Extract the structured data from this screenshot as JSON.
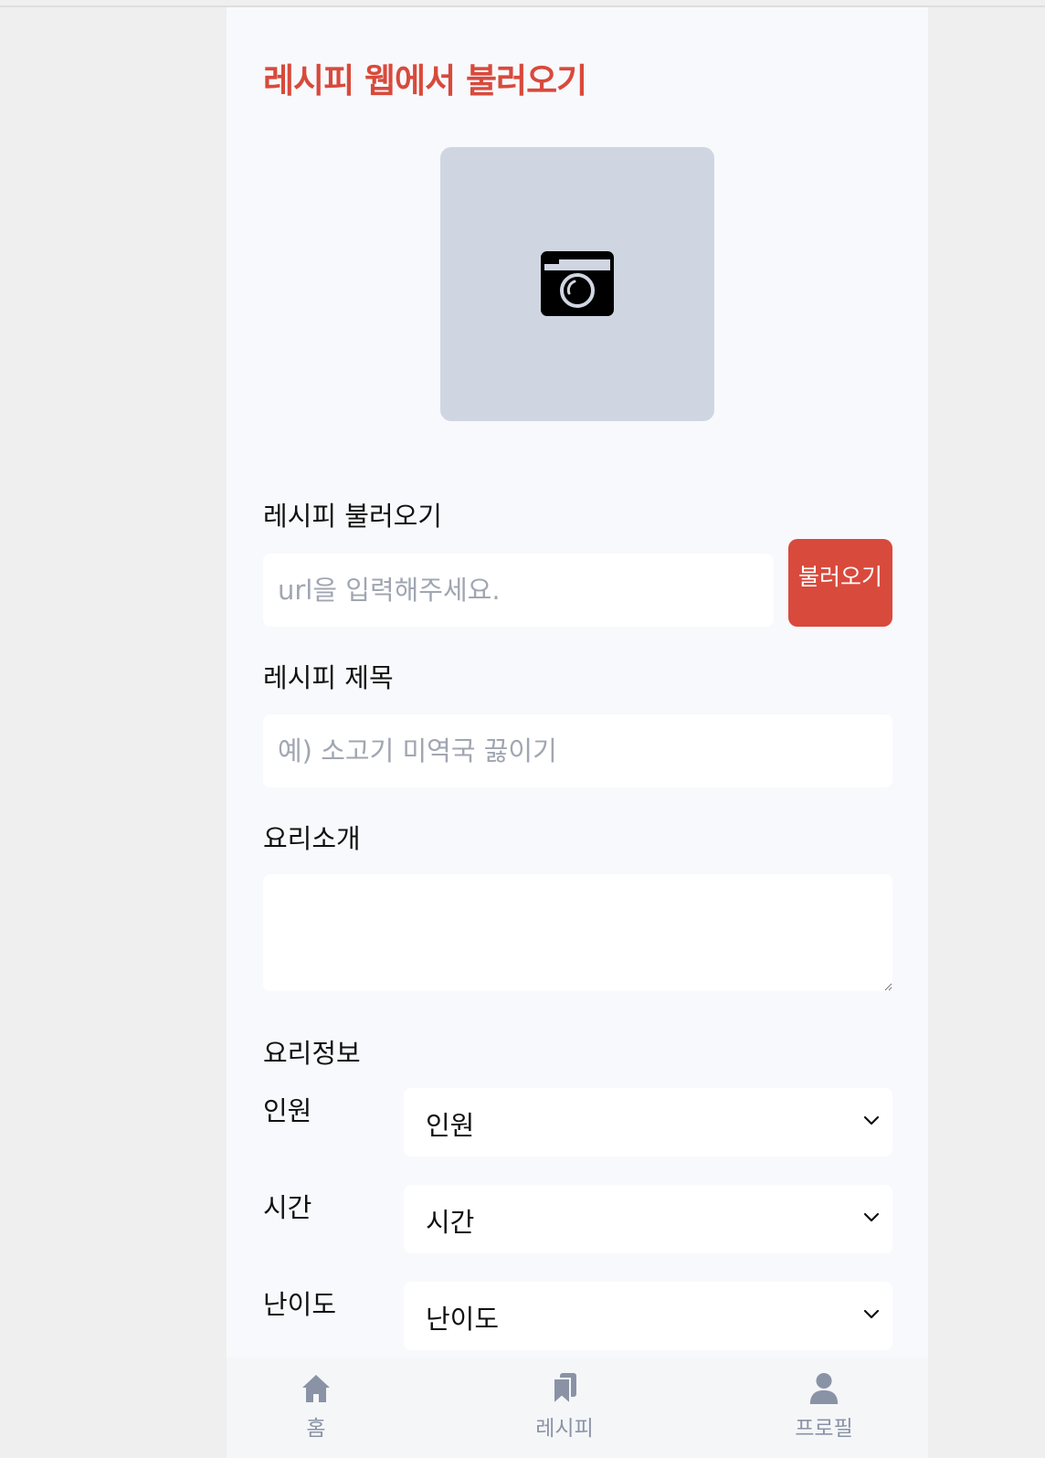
{
  "header": {
    "title": "레시피 웹에서 불러오기"
  },
  "photo": {
    "icon": "camera-icon"
  },
  "import_section": {
    "label": "레시피 불러오기",
    "url_placeholder": "url을 입력해주세요.",
    "url_value": "",
    "button_label": "불러오기"
  },
  "title_section": {
    "label": "레시피 제목",
    "placeholder": "예) 소고기 미역국 끓이기",
    "value": ""
  },
  "intro_section": {
    "label": "요리소개",
    "value": ""
  },
  "info_section": {
    "label": "요리정보",
    "rows": [
      {
        "label": "인원",
        "selected": "인원"
      },
      {
        "label": "시간",
        "selected": "시간"
      },
      {
        "label": "난이도",
        "selected": "난이도"
      }
    ]
  },
  "bottom_nav": {
    "items": [
      {
        "label": "홈",
        "icon": "home-icon"
      },
      {
        "label": "레시피",
        "icon": "bookmark-icon"
      },
      {
        "label": "프로필",
        "icon": "user-icon"
      }
    ]
  },
  "colors": {
    "accent": "#d84a3c",
    "photo_bg": "#d0d6e1",
    "page_bg": "#f8f9fc",
    "nav_icon": "#8a93a6"
  }
}
